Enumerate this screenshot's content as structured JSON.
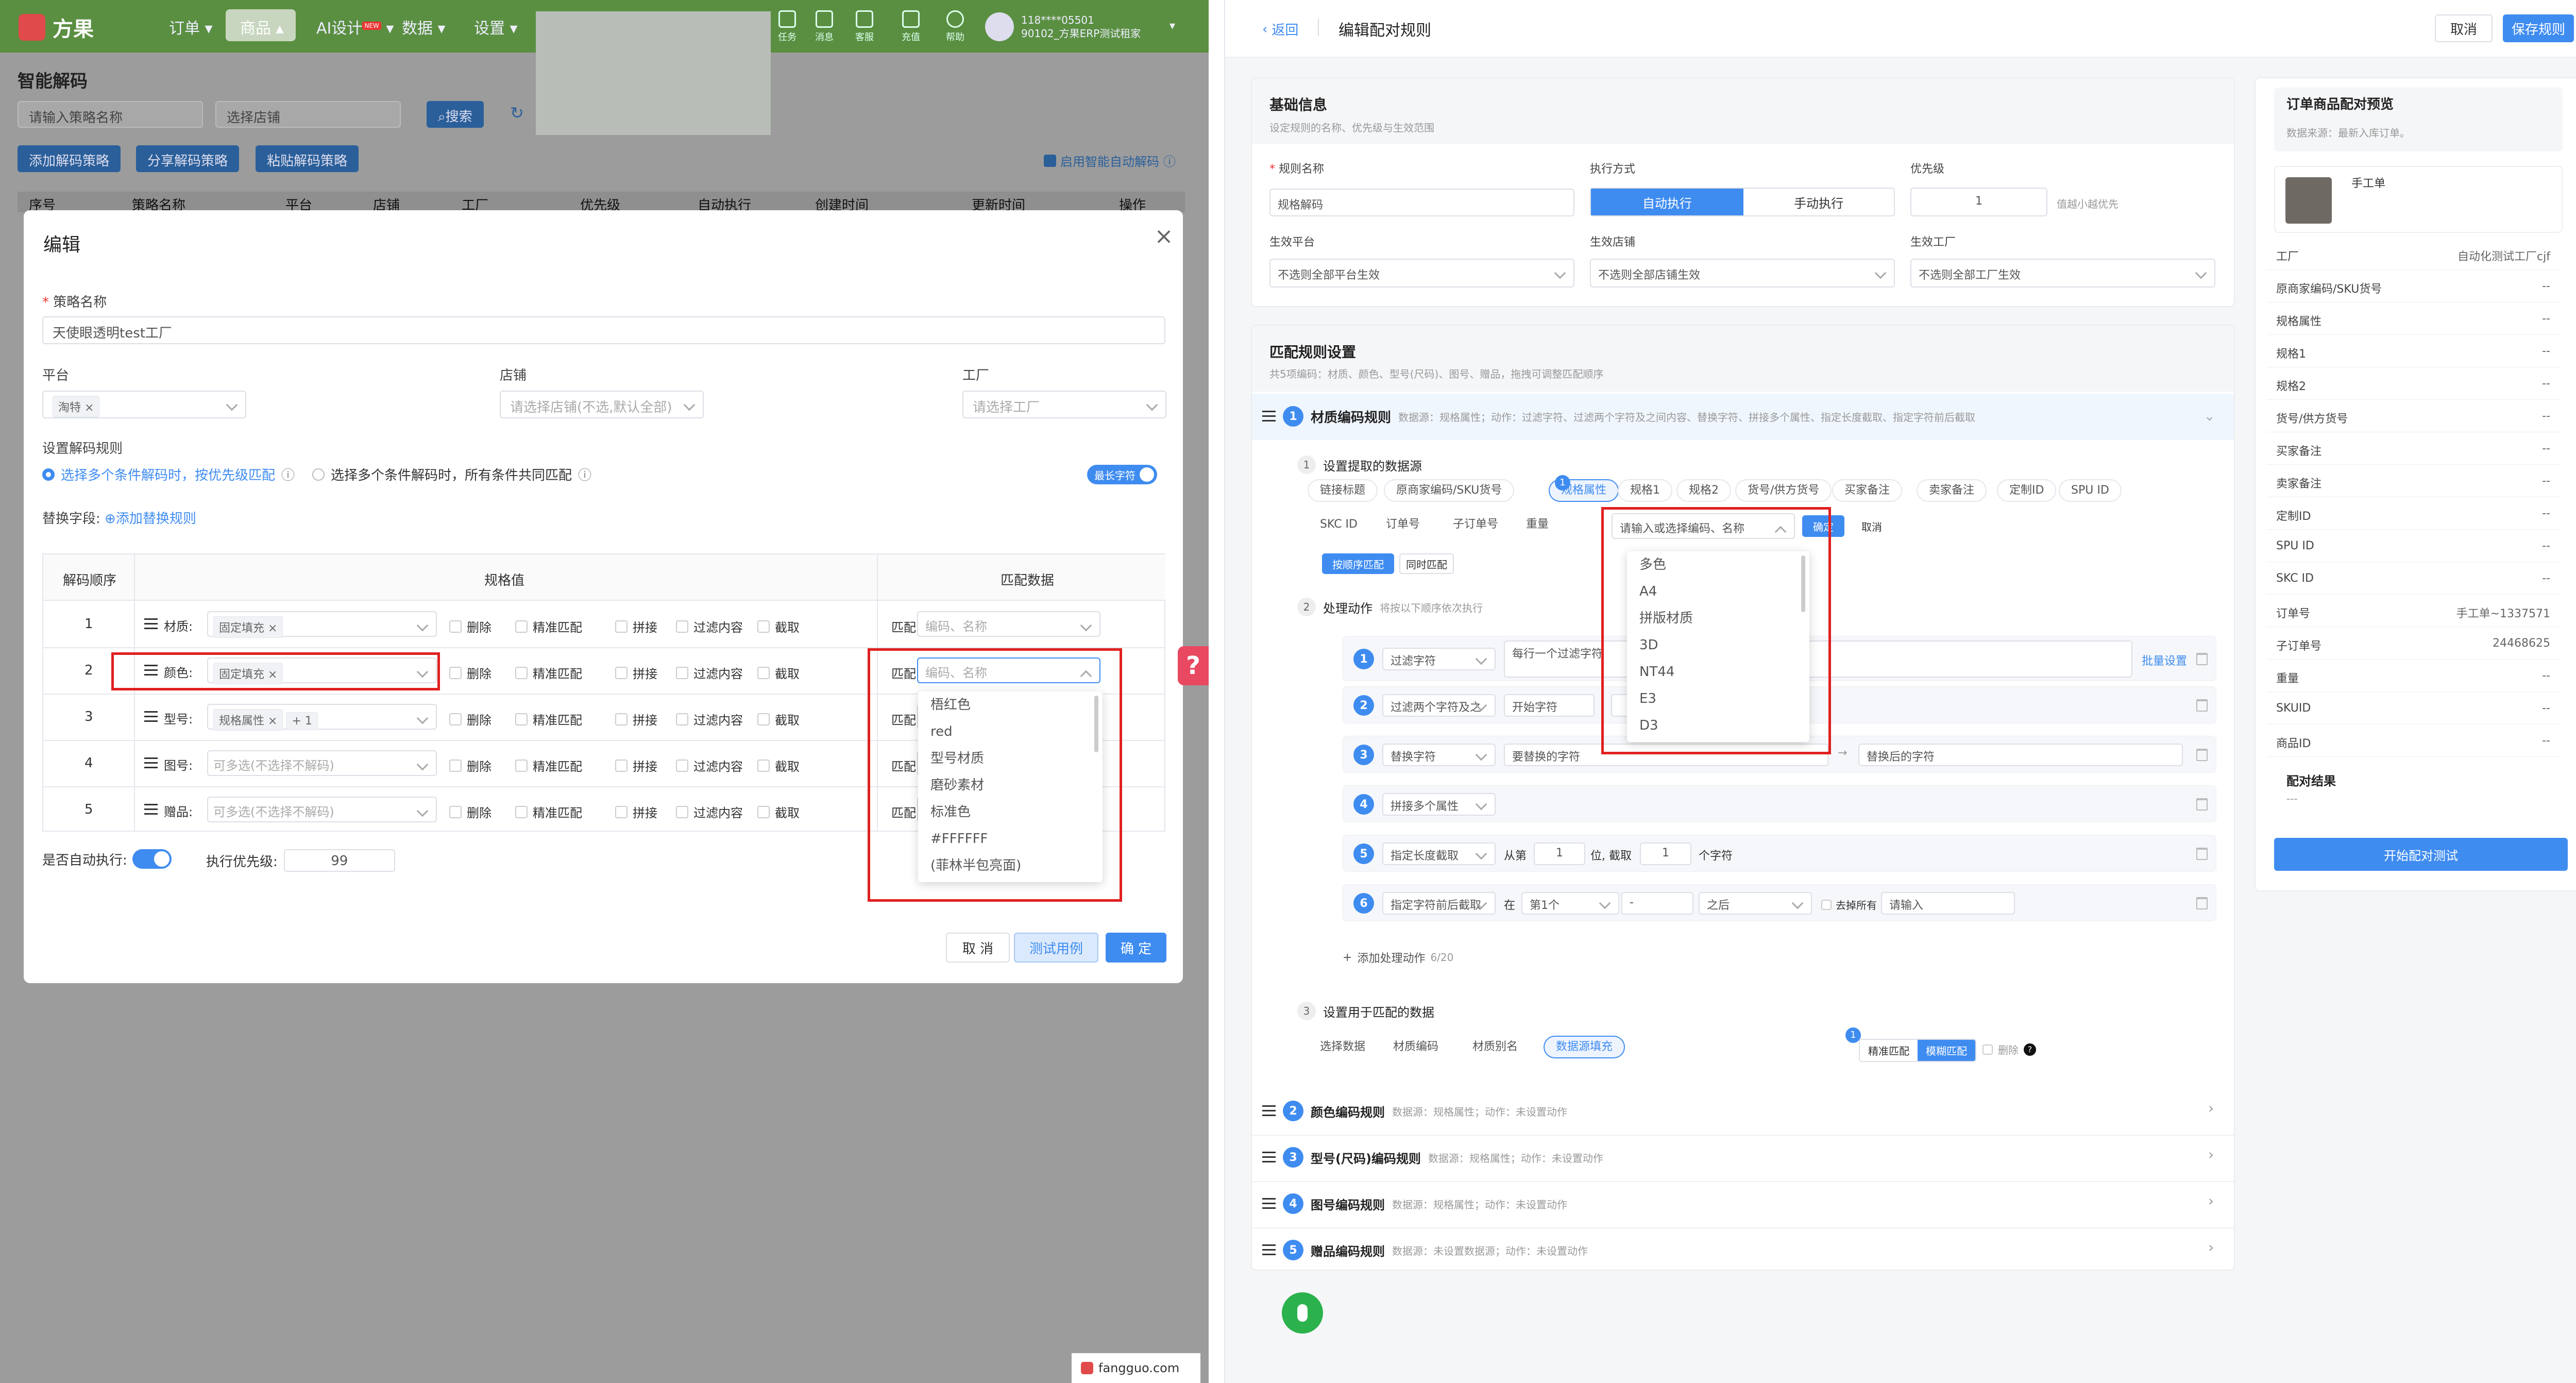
{
  "left": {
    "topnav": {
      "brand": "方果",
      "items": [
        "订单",
        "商品",
        "AI设计",
        "数据",
        "设置"
      ],
      "ai_badge": "NEW",
      "icons": [
        "任务",
        "消息",
        "客服",
        "充值",
        "帮助"
      ],
      "user_line1": "118****05501",
      "user_line2": "90102_方果ERP测试租家"
    },
    "page_title": "智能解码",
    "search_placeholder": "请输入策略名称",
    "store_placeholder": "选择店铺",
    "search_btn": "搜索",
    "btn_add": "添加解码策略",
    "btn_share": "分享解码策略",
    "btn_paste": "粘贴解码策略",
    "auto_decode": "启用智能自动解码",
    "table_headers": [
      "序号",
      "策略名称",
      "平台",
      "店铺",
      "工厂",
      "优先级",
      "自动执行",
      "创建时间",
      "更新时间",
      "操作"
    ]
  },
  "modal": {
    "title": "编辑",
    "strategy_label": "策略名称",
    "strategy_value": "天使眼透明test工厂",
    "platform_label": "平台",
    "platform_tag": "淘特",
    "store_label": "店铺",
    "store_placeholder": "请选择店铺(不选,默认全部)",
    "factory_label": "工厂",
    "factory_placeholder": "请选择工厂",
    "rule_label": "设置解码规则",
    "radio1": "选择多个条件解码时，按优先级匹配",
    "radio2": "选择多个条件解码时，所有条件共同匹配",
    "longest_match": "最长字符",
    "replace_label": "替换字段:",
    "add_replace": "添加替换规则",
    "col_order": "解码顺序",
    "col_spec": "规格值",
    "col_match": "匹配数据",
    "rows": [
      {
        "no": "1",
        "name": "材质:",
        "tag": "固定填充",
        "tag2": "",
        "ph": "",
        "match_ph": "编码、名称"
      },
      {
        "no": "2",
        "name": "颜色:",
        "tag": "固定填充",
        "tag2": "",
        "ph": "",
        "match_ph": "编码、名称"
      },
      {
        "no": "3",
        "name": "型号:",
        "tag": "规格属性",
        "tag2": "+ 1",
        "ph": "",
        "match_ph": ""
      },
      {
        "no": "4",
        "name": "图号:",
        "tag": "",
        "tag2": "",
        "ph": "可多选(不选择不解码)",
        "match_ph": ""
      },
      {
        "no": "5",
        "name": "赠品:",
        "tag": "",
        "tag2": "",
        "ph": "可多选(不选择不解码)",
        "match_ph": ""
      }
    ],
    "opt_delete": "删除",
    "opt_exact": "精准匹配",
    "opt_join": "拼接",
    "opt_filter": "过滤内容",
    "opt_cut": "截取",
    "match_word": "匹配",
    "dropdown": [
      "梧红色",
      "red",
      "型号材质",
      "磨砂素材",
      "标准色",
      "#FFFFFF",
      "(菲林半包亮面)"
    ],
    "auto_exec": "是否自动执行:",
    "exec_priority": "执行优先级:",
    "priority_value": "99",
    "btn_cancel": "取 消",
    "btn_test": "测试用例",
    "btn_ok": "确 定"
  },
  "footer_site": "fangguo.com",
  "right": {
    "back": "返回",
    "title": "编辑配对规则",
    "btn_cancel": "取消",
    "btn_save": "保存规则",
    "basic": {
      "title": "基础信息",
      "sub": "设定规则的名称、优先级与生效范围",
      "name_label": "规则名称",
      "name_value": "规格解码",
      "exec_label": "执行方式",
      "exec_auto": "自动执行",
      "exec_manual": "手动执行",
      "prio_label": "优先级",
      "prio_value": "1",
      "prio_hint": "值越小越优先",
      "plat_label": "生效平台",
      "plat_ph": "不选则全部平台生效",
      "store_label": "生效店铺",
      "store_ph": "不选则全部店铺生效",
      "fac_label": "生效工厂",
      "fac_ph": "不选则全部工厂生效"
    },
    "match": {
      "title": "匹配规则设置",
      "sub": "共5项编码：材质、颜色、型号(尺码)、图号、赠品，拖拽可调整匹配顺序",
      "rule1": "材质编码规则",
      "rule1_desc": "数据源：规格属性；动作：过滤字符、过滤两个字符及之间内容、替换字符、拼接多个属性、指定长度截取、指定字符前后截取",
      "step1": "设置提取的数据源",
      "sources": [
        "链接标题",
        "原商家编码/SKU货号",
        "规格属性",
        "规格1",
        "规格2",
        "货号/供方货号",
        "买家备注",
        "卖家备注",
        "定制ID",
        "SPU ID",
        "SKC ID",
        "订单号",
        "子订单号",
        "重量"
      ],
      "src_badge": "1",
      "src_input_ph": "请输入或选择编码、名称",
      "src_ok": "确定",
      "src_cancel": "取消",
      "src_dropdown": [
        "多色",
        "A4",
        "拼版材质",
        "3D",
        "NT44",
        "E3",
        "D3"
      ],
      "seq_match": "按顺序匹配",
      "same_match": "同时匹配",
      "step2": "处理动作",
      "step2_sub": "将按以下顺序依次执行",
      "actions": [
        {
          "n": "1",
          "name": "过滤字符",
          "ph": "每行一个过滤字符",
          "extra": "批量设置"
        },
        {
          "n": "2",
          "name": "过滤两个字符及之",
          "ph": "开始字符",
          "extra": ""
        },
        {
          "n": "3",
          "name": "替换字符",
          "ph": "要替换的字符",
          "ph2": "替换后的字符",
          "extra": ""
        },
        {
          "n": "4",
          "name": "拼接多个属性",
          "ph": "",
          "extra": ""
        },
        {
          "n": "5",
          "name": "指定长度截取",
          "from": "从第",
          "v1": "1",
          "mid": "位, 截取",
          "v2": "1",
          "tail": "个字符"
        },
        {
          "n": "6",
          "name": "指定字符前后截取",
          "at": "在",
          "sel": "第1个",
          "dash": "-",
          "after": "之后",
          "strip": "去掉所有",
          "ph": "请输入"
        }
      ],
      "add_action": "添加处理动作",
      "add_count": "6/20",
      "step3": "设置用于匹配的数据",
      "match_sources": [
        "选择数据",
        "材质编码",
        "材质别名",
        "数据源填充"
      ],
      "match_badge": "1",
      "exact": "精准匹配",
      "fuzzy": "模糊匹配",
      "delete": "删除",
      "rules": [
        {
          "n": "2",
          "name": "颜色编码规则",
          "desc": "数据源：规格属性；动作：未设置动作"
        },
        {
          "n": "3",
          "name": "型号(尺码)编码规则",
          "desc": "数据源：规格属性；动作：未设置动作"
        },
        {
          "n": "4",
          "name": "图号编码规则",
          "desc": "数据源：规格属性；动作：未设置动作"
        },
        {
          "n": "5",
          "name": "赠品编码规则",
          "desc": "数据源：未设置数据源；动作：未设置动作"
        }
      ]
    },
    "preview": {
      "title": "订单商品配对预览",
      "sub": "数据来源：最新入库订单。",
      "product": "手工单",
      "rows": [
        {
          "k": "工厂",
          "v": "自动化测试工厂cjf"
        },
        {
          "k": "原商家编码/SKU货号",
          "v": "--"
        },
        {
          "k": "规格属性",
          "v": "--"
        },
        {
          "k": "规格1",
          "v": "--"
        },
        {
          "k": "规格2",
          "v": "--"
        },
        {
          "k": "货号/供方货号",
          "v": "--"
        },
        {
          "k": "买家备注",
          "v": "--"
        },
        {
          "k": "卖家备注",
          "v": "--"
        },
        {
          "k": "定制ID",
          "v": "--"
        },
        {
          "k": "SPU ID",
          "v": "--"
        },
        {
          "k": "SKC ID",
          "v": "--"
        },
        {
          "k": "订单号",
          "v": "手工单~1337571"
        },
        {
          "k": "子订单号",
          "v": "24468625"
        },
        {
          "k": "重量",
          "v": "--"
        },
        {
          "k": "SKUID",
          "v": "--"
        },
        {
          "k": "商品ID",
          "v": "--"
        }
      ],
      "result_title": "配对结果",
      "result_value": "---",
      "btn_test": "开始配对测试"
    }
  },
  "colors": {
    "primary": "#3f8cf0",
    "nav_green": "#5a8f41",
    "red_box": "#e02020",
    "help_red": "#e84860",
    "mic_green": "#2bb24c"
  }
}
